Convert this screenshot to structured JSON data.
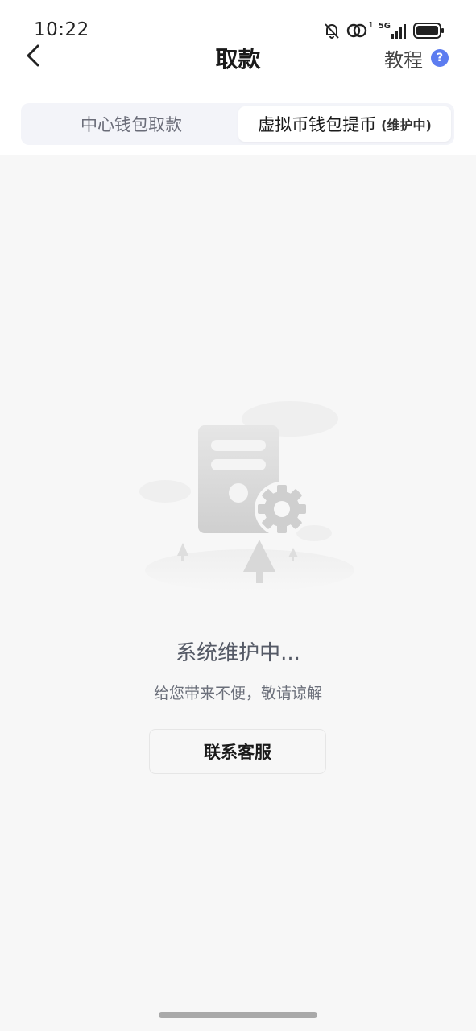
{
  "status_bar": {
    "time": "10:22",
    "network": "5G",
    "sim_index": "1",
    "icons": [
      "bell-mute-icon",
      "hotspot-icon",
      "signal-icon",
      "battery-icon"
    ]
  },
  "nav": {
    "title": "取款",
    "tutorial_label": "教程",
    "help_symbol": "?",
    "back_icon": "chevron-left-icon"
  },
  "tabs": [
    {
      "label": "中心钱包取款",
      "note": "",
      "active": false
    },
    {
      "label": "虚拟币钱包提币",
      "note": "(维护中)",
      "active": true
    }
  ],
  "maintenance": {
    "title": "系统维护中...",
    "subtitle": "给您带来不便，敬请谅解",
    "contact_label": "联系客服",
    "illustration_icon": "server-maintenance-illustration"
  },
  "colors": {
    "accent": "#5c7cf0",
    "background": "#f7f7f7",
    "header_bg": "#ffffff"
  }
}
